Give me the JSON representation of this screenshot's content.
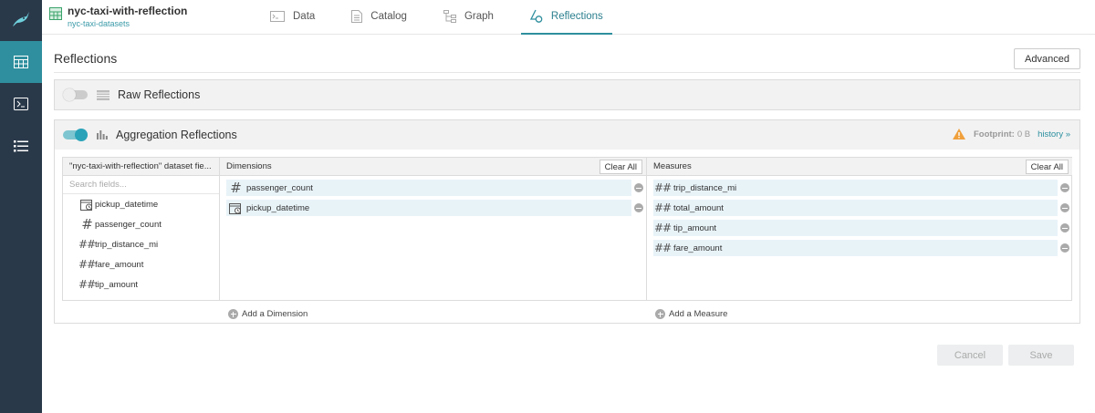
{
  "dataset": {
    "title": "nyc-taxi-with-reflection",
    "subtitle": "nyc-taxi-datasets"
  },
  "tabs": [
    {
      "label": "Data",
      "icon": "terminal-icon",
      "active": false
    },
    {
      "label": "Catalog",
      "icon": "document-icon",
      "active": false
    },
    {
      "label": "Graph",
      "icon": "graph-icon",
      "active": false
    },
    {
      "label": "Reflections",
      "icon": "reflections-icon",
      "active": true
    }
  ],
  "page": {
    "title": "Reflections",
    "advanced_label": "Advanced"
  },
  "raw": {
    "label": "Raw Reflections",
    "enabled": false
  },
  "aggregation": {
    "label": "Aggregation Reflections",
    "enabled": true,
    "footprint_label": "Footprint:",
    "footprint_value": "0 B",
    "history_label": "history »",
    "fields_header": "\"nyc-taxi-with-reflection\" dataset fie...",
    "search_placeholder": "Search fields...",
    "fields": [
      {
        "name": "pickup_datetime",
        "type": "datetime"
      },
      {
        "name": "passenger_count",
        "type": "integer"
      },
      {
        "name": "trip_distance_mi",
        "type": "decimal"
      },
      {
        "name": "fare_amount",
        "type": "decimal"
      },
      {
        "name": "tip_amount",
        "type": "decimal"
      }
    ],
    "dimensions_header": "Dimensions",
    "dimensions": [
      {
        "name": "passenger_count",
        "type": "integer"
      },
      {
        "name": "pickup_datetime",
        "type": "datetime"
      }
    ],
    "measures_header": "Measures",
    "measures": [
      {
        "name": "trip_distance_mi",
        "type": "decimal"
      },
      {
        "name": "total_amount",
        "type": "decimal"
      },
      {
        "name": "tip_amount",
        "type": "decimal"
      },
      {
        "name": "fare_amount",
        "type": "decimal"
      }
    ],
    "clear_all_label": "Clear All",
    "add_dimension_label": "Add a Dimension",
    "add_measure_label": "Add a Measure"
  },
  "footer": {
    "cancel_label": "Cancel",
    "save_label": "Save"
  },
  "colors": {
    "accent": "#2f8f9e",
    "rail": "#2a394a",
    "chip": "#e8f3f8",
    "warning": "#f0a03c"
  }
}
